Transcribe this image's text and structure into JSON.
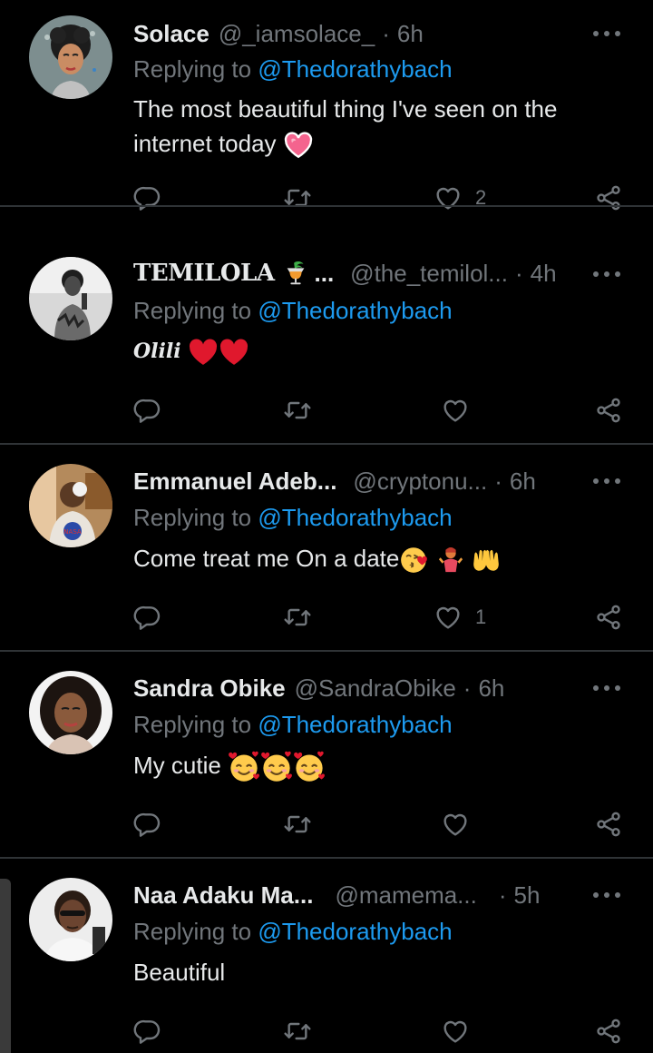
{
  "replying_prefix": "Replying to",
  "colors": {
    "background": "#000000",
    "text": "#e7e9ea",
    "muted": "#71767b",
    "mention": "#1d9bf0",
    "divider": "#2f3336"
  },
  "icons": {
    "reply": "reply-icon",
    "retweet": "retweet-icon",
    "like": "heart-icon",
    "share": "share-icon",
    "more": "more-icon"
  },
  "tweets": [
    {
      "name": "Solace",
      "handle": "@_iamsolace_",
      "separator": "·",
      "time": "6h",
      "mention": "@Thedorathybach",
      "text": "The most beautiful thing I've seen on the internet today",
      "emojis": [
        "heart-with-ribbon"
      ],
      "likes": "2"
    },
    {
      "name": "TEMILOLA",
      "name_emojis": [
        "tropical-drink"
      ],
      "name_ellipsis": "...",
      "handle": "@the_temilol...",
      "separator": "·",
      "time": "4h",
      "mention": "@Thedorathybach",
      "text": "Olili",
      "emojis": [
        "red-heart",
        "red-heart"
      ],
      "likes": ""
    },
    {
      "name": "Emmanuel Adeb...",
      "handle": "@cryptonu...",
      "separator": "·",
      "time": "6h",
      "mention": "@Thedorathybach",
      "text": "Come treat me On a date",
      "emojis": [
        "face-blowing-kiss",
        "person-shrugging",
        "palms-up-together"
      ],
      "likes": "1"
    },
    {
      "name": "Sandra Obike",
      "handle": "@SandraObike",
      "separator": "·",
      "time": "6h",
      "mention": "@Thedorathybach",
      "text": "My cutie",
      "emojis": [
        "smiling-face-with-hearts",
        "smiling-face-with-hearts",
        "smiling-face-with-hearts"
      ],
      "likes": ""
    },
    {
      "name": "Naa Adaku Ma...",
      "handle": "@mamema...",
      "separator": "·",
      "time": "5h",
      "mention": "@Thedorathybach",
      "text": "Beautiful",
      "emojis": [],
      "likes": ""
    }
  ]
}
